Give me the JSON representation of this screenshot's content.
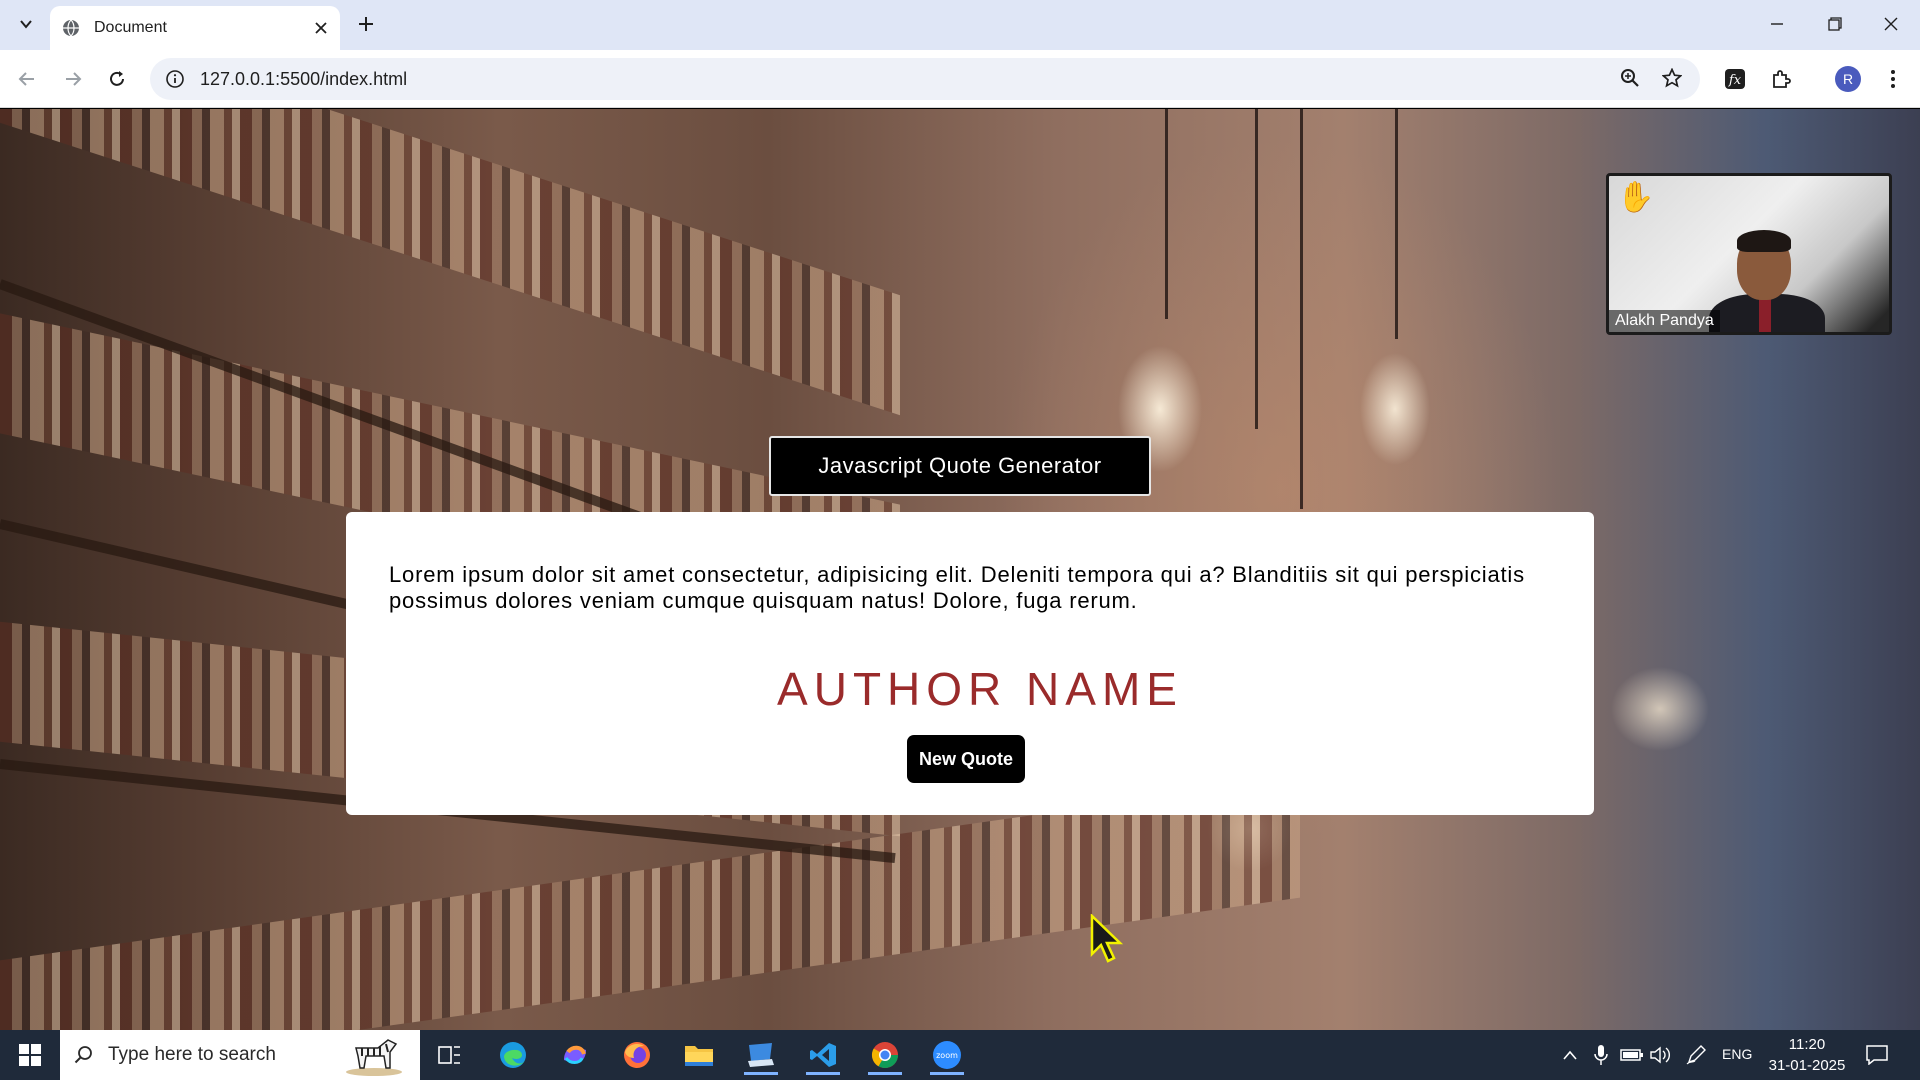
{
  "browser": {
    "tab_title": "Document",
    "url": "127.0.0.1:5500/index.html",
    "profile_initial": "R"
  },
  "page": {
    "title": "Javascript Quote Generator",
    "quote": "Lorem ipsum dolor sit amet consectetur, adipisicing elit. Deleniti tempora qui a? Blanditiis sit qui perspiciatis possimus dolores veniam cumque quisquam natus! Dolore, fuga rerum.",
    "author": "AUTHOR NAME",
    "new_quote_label": "New Quote"
  },
  "video_call": {
    "participant_name": "Alakh Pandya"
  },
  "taskbar": {
    "search_placeholder": "Type here to search",
    "language": "ENG",
    "time": "11:20",
    "date": "31-01-2025"
  },
  "colors": {
    "author": "#9a2b2b",
    "title_bg": "#000000",
    "card_bg": "#ffffff",
    "tabstrip": "#dfe6f6",
    "taskbar": "#1f2a3a"
  }
}
